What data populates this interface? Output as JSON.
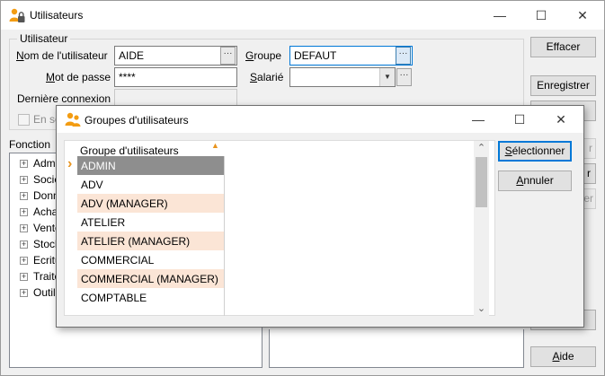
{
  "window": {
    "title": "Utilisateurs",
    "minimize": "—",
    "maximize": "☐",
    "close": "✕"
  },
  "form": {
    "group_title": "Utilisateur",
    "username_label": "Nom de l'utilisateur",
    "username_value": "AIDE",
    "password_label": "Mot de passe",
    "password_value": "****",
    "last_login_label": "Dernière connexion",
    "last_login_value": "",
    "groupe_label": "Groupe",
    "groupe_value": "DEFAUT",
    "salarie_label": "Salarié",
    "salarie_value": "",
    "checkbox_label": "En so",
    "browse": "···",
    "dropdown_arrow": "▼"
  },
  "functions": {
    "label": "Fonction",
    "items": [
      "Adm",
      "Socié",
      "Donn",
      "Acha",
      "Vente",
      "Stock",
      "Ecritu",
      "Traite",
      "Outil"
    ]
  },
  "buttons": {
    "effacer": "Effacer",
    "enregistrer": "Enregistrer",
    "aide": "Aide",
    "partial_1": "r",
    "partial_2": "r",
    "partial_3": "er"
  },
  "dialog": {
    "title": "Groupes d'utilisateurs",
    "column_header": "Groupe d'utilisateurs",
    "sort_indicator": "▲",
    "row_marker": "›",
    "rows": [
      "ADMIN",
      "ADV",
      "ADV (MANAGER)",
      "ATELIER",
      "ATELIER (MANAGER)",
      "COMMERCIAL",
      "COMMERCIAL (MANAGER)",
      "COMPTABLE"
    ],
    "selectionner": "Sélectionner",
    "annuler": "Annuler",
    "minimize": "—",
    "maximize": "☐",
    "close": "✕",
    "scroll_up": "⌃",
    "scroll_down": "⌄"
  },
  "colors": {
    "accent": "#0078d7",
    "selected_row": "#8e8e8e",
    "alt_row": "#fbe5d6",
    "sort_indicator": "#e8941e",
    "icon_orange": "#f39c12"
  }
}
